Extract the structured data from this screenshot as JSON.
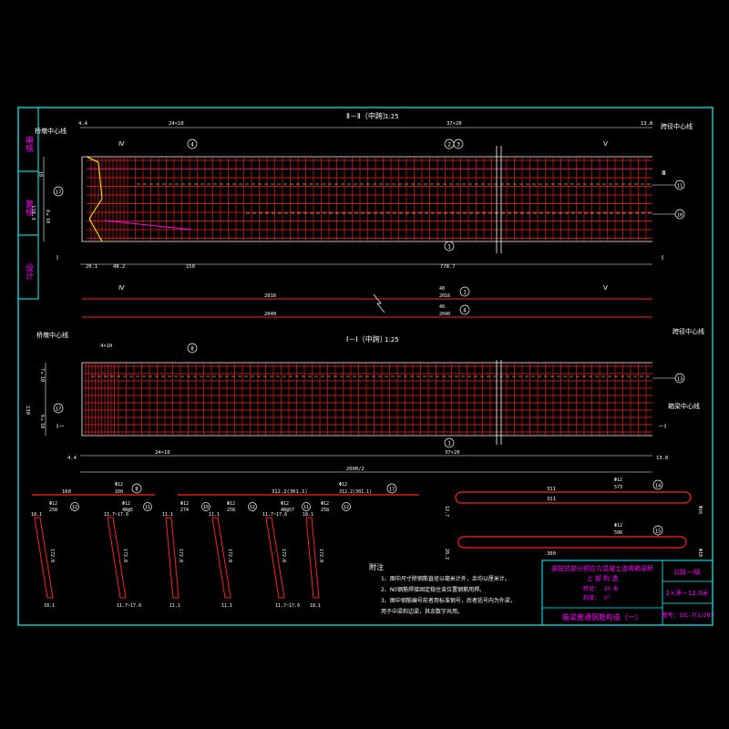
{
  "colors": {
    "background": "#000000",
    "border": "#00ffff",
    "rebar": "#ff2020",
    "dimension": "#ffffff",
    "accent_yellow": "#ffff00",
    "accent_magenta": "#ff00ff",
    "label_circle": "#ffffff"
  },
  "side_stamp": {
    "items": [
      "审核",
      "复核",
      "设计"
    ]
  },
  "section_top": {
    "title": "Ⅱ－Ⅱ（中跨）",
    "scale": "1:25",
    "left_label": "桥墩中心线",
    "right_label": "跨径中心线",
    "dims_top": [
      "4.4",
      "24×10",
      "37×20",
      "13.8"
    ],
    "dims_bottom": [
      "20.1",
      "48.2",
      "150",
      "778.7"
    ],
    "dims_left": [
      "10",
      "118.3",
      "8×10"
    ],
    "cut_marks": [
      "Ⅳ",
      "Ⅳ",
      "Ⅲ",
      "Ⅲ"
    ],
    "callouts": [
      "4",
      "2",
      "3",
      "11",
      "10",
      "17",
      "1"
    ]
  },
  "long_bars": [
    {
      "label": "2016",
      "qty": "48",
      "sub": "2016",
      "ref": "1"
    },
    {
      "label": "2040",
      "qty": "48",
      "sub": "2040",
      "ref": "4"
    }
  ],
  "section_bottom": {
    "title": "Ⅰ－Ⅰ（中跨）",
    "scale": "1:25",
    "left_label": "桥墩中心线",
    "right_label_top": "跨径中心线",
    "right_label_bottom": "箱梁中心线",
    "dims_top": [
      "4×10"
    ],
    "dims_bottom": [
      "4.4",
      "24×10",
      "37×20",
      "13.8",
      "2000/2"
    ],
    "dims_left": [
      "130",
      "7×10",
      "6×10"
    ],
    "callouts": [
      "8",
      "13",
      "17",
      "1"
    ]
  },
  "bar_details": {
    "long_items": [
      {
        "len": "160",
        "dia": "Φ12",
        "sub": "160",
        "ref": "8"
      },
      {
        "len": "312.2(301.1)",
        "dia": "Φ12",
        "sub": "312.2(301.1)",
        "ref": "17"
      }
    ],
    "slanted": [
      {
        "ref": "12",
        "dia": "Φ12",
        "qty": "258",
        "top": "18.1",
        "bottom": "18.1",
        "side": "172.0"
      },
      {
        "ref": "11",
        "dia": "Φ12",
        "qty": "48@5",
        "top": "11.7~17.6",
        "bottom": "11.7~17.6",
        "side": "172.0"
      },
      {
        "ref": "10",
        "dia": "Φ12",
        "qty": "274",
        "top": "11.1",
        "bottom": "11.1",
        "side": "172.0"
      },
      {
        "ref": "12",
        "dia": "Φ12",
        "qty": "258",
        "top": "11.1",
        "bottom": "11.1",
        "side": "172.0"
      },
      {
        "ref": "11",
        "dia": "Φ12",
        "qty": "48@57",
        "top": "11.7~17.6",
        "bottom": "11.7~17.6",
        "side": "172.0"
      },
      {
        "ref": "12",
        "dia": "Φ12",
        "qty": "258",
        "top": "18.1",
        "bottom": "18.1",
        "side": "172.0"
      }
    ],
    "loops": [
      {
        "ref": "14",
        "dia": "Φ12",
        "qty": "573",
        "len": "311",
        "h": "12.7",
        "r": "Φ16"
      },
      {
        "ref": "15",
        "dia": "Φ12",
        "qty": "508",
        "len": "300",
        "h": "28.2",
        "r": "Φ10"
      }
    ]
  },
  "notes": {
    "heading": "附注",
    "lines": [
      "1、图中尺寸除钢筋直径以毫米计外，余均以厘米计。",
      "2、N0钢筋焊接固定稳住束位置钢筋用焊。",
      "3、图中钢筋编号前者用标准钢号，后者括号内为外梁，",
      "   用于中梁和边梁，其余数字共用。"
    ]
  },
  "title_block": {
    "project_line1": "装配式部分预应力混凝土连续箱梁桥",
    "project_line2": "上 部 构 造",
    "span_label": "跨径：",
    "span_value": "20 米",
    "skew_label": "斜度：",
    "skew_value": "0°",
    "drawing_title": "箱梁普通钢筋构造（一）",
    "load_class": "公路－Ⅰ级",
    "width": "2×净－12.0米",
    "drawing_no": "图号：SIC-7(1/28)"
  }
}
